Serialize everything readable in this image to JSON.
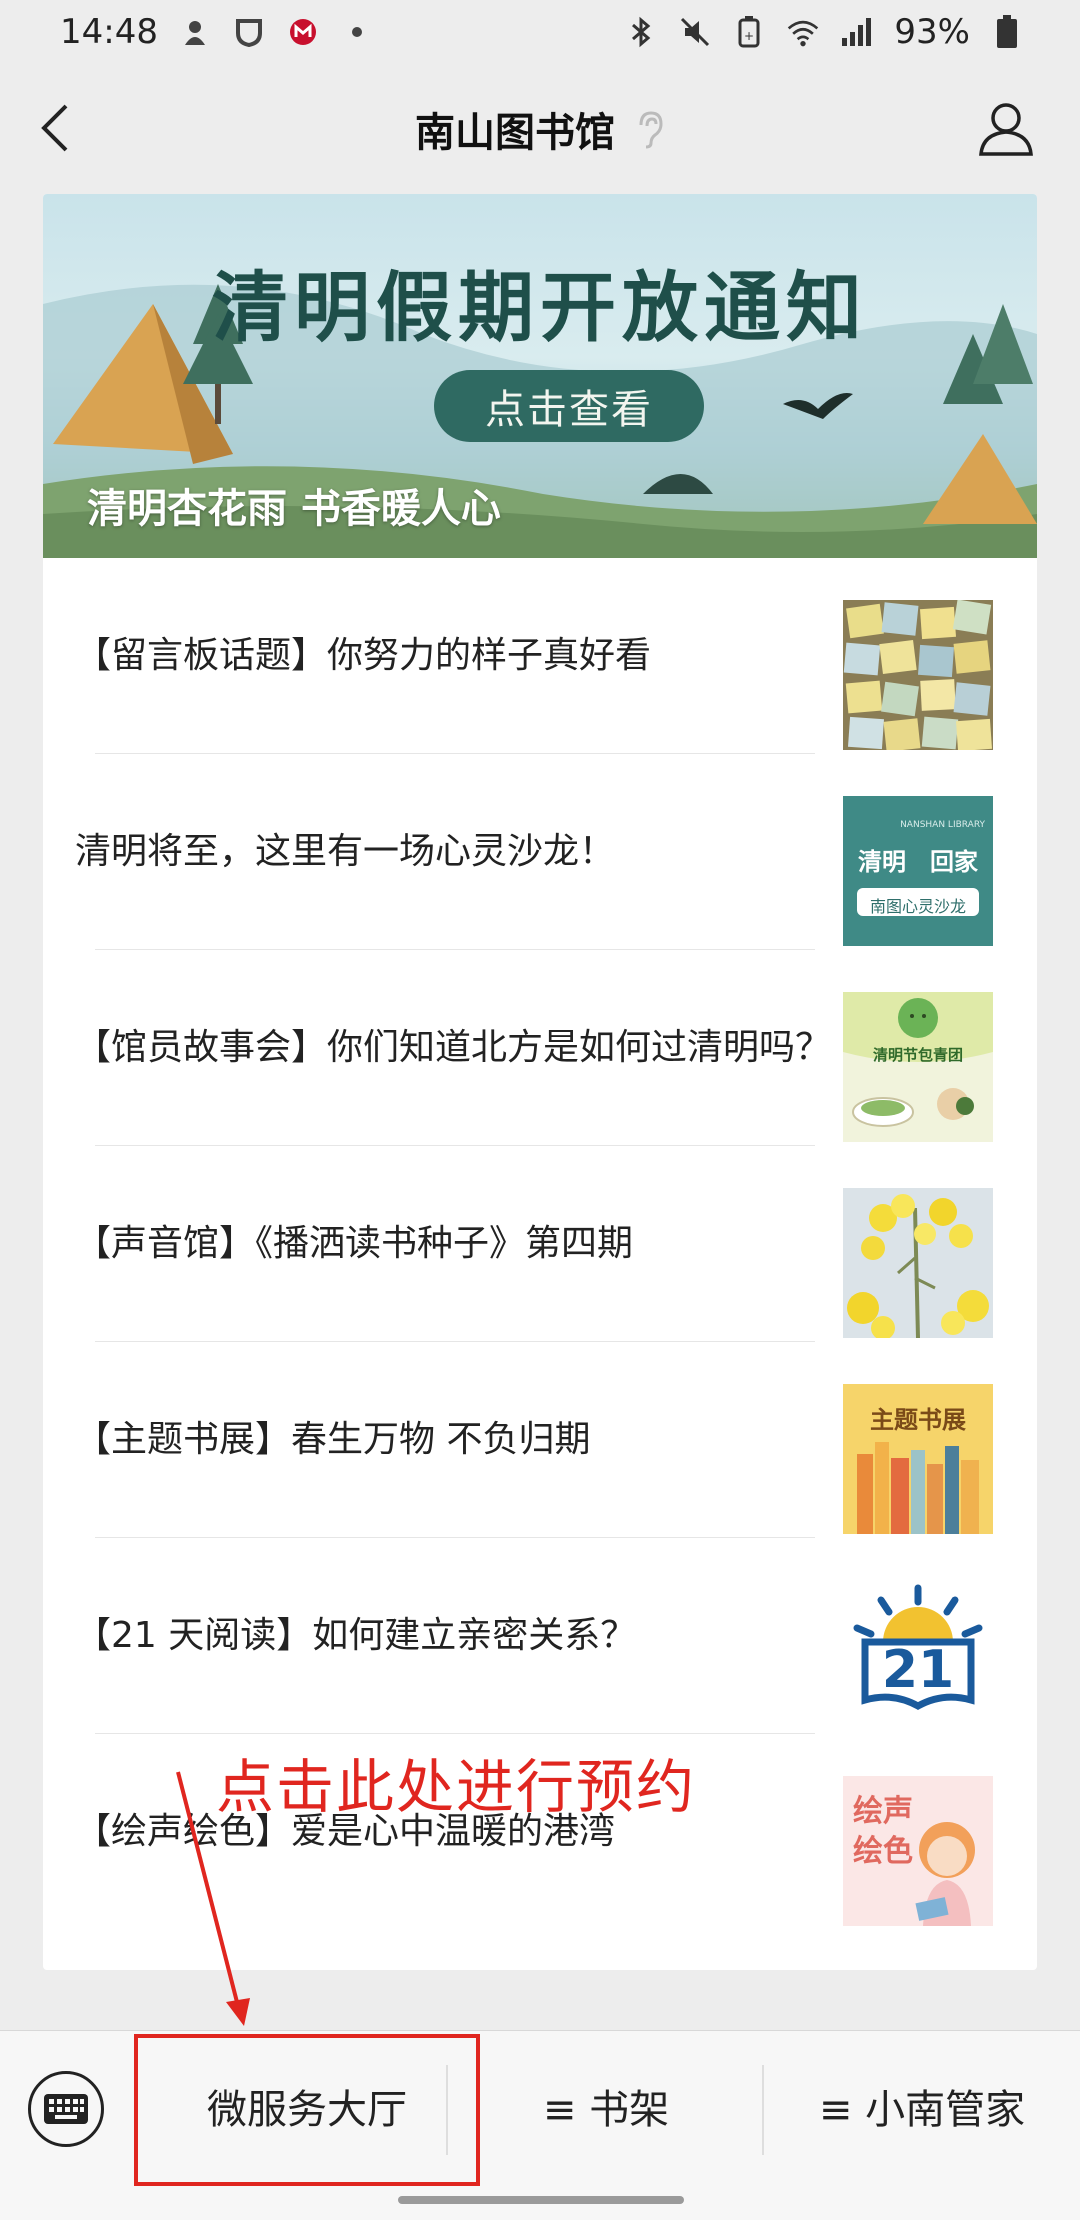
{
  "status_bar": {
    "time": "14:48",
    "battery": "93%"
  },
  "header": {
    "title": "南山图书馆"
  },
  "banner": {
    "headline": "清明假期开放通知",
    "button_label": "点击查看",
    "caption": "清明杏花雨 书香暖人心"
  },
  "articles": [
    {
      "title": "【留言板话题】你努力的样子真好看"
    },
    {
      "title": "清明将至，这里有一场心灵沙龙！",
      "thumb_text": [
        "NANSHAN LIBRARY",
        "清明　回家",
        "南图心灵沙龙"
      ]
    },
    {
      "title": "【馆员故事会】你们知道北方是如何过清明吗？",
      "thumb_text": [
        "清明节包青团"
      ]
    },
    {
      "title": "【声音馆】《播洒读书种子》第四期"
    },
    {
      "title": "【主题书展】春生万物 不负归期",
      "thumb_text": [
        "主题书展"
      ]
    },
    {
      "title": "【21 天阅读】如何建立亲密关系？",
      "thumb_text": [
        "21"
      ]
    },
    {
      "title": "【绘声绘色】爱是心中温暖的港湾",
      "thumb_text": [
        "绘声",
        "绘色"
      ]
    }
  ],
  "annotation": {
    "text": "点击此处进行预约",
    "color": "#e0261f"
  },
  "bottom_menu": {
    "items": [
      "微服务大厅",
      "≡ 书架",
      "≡ 小南管家"
    ]
  }
}
